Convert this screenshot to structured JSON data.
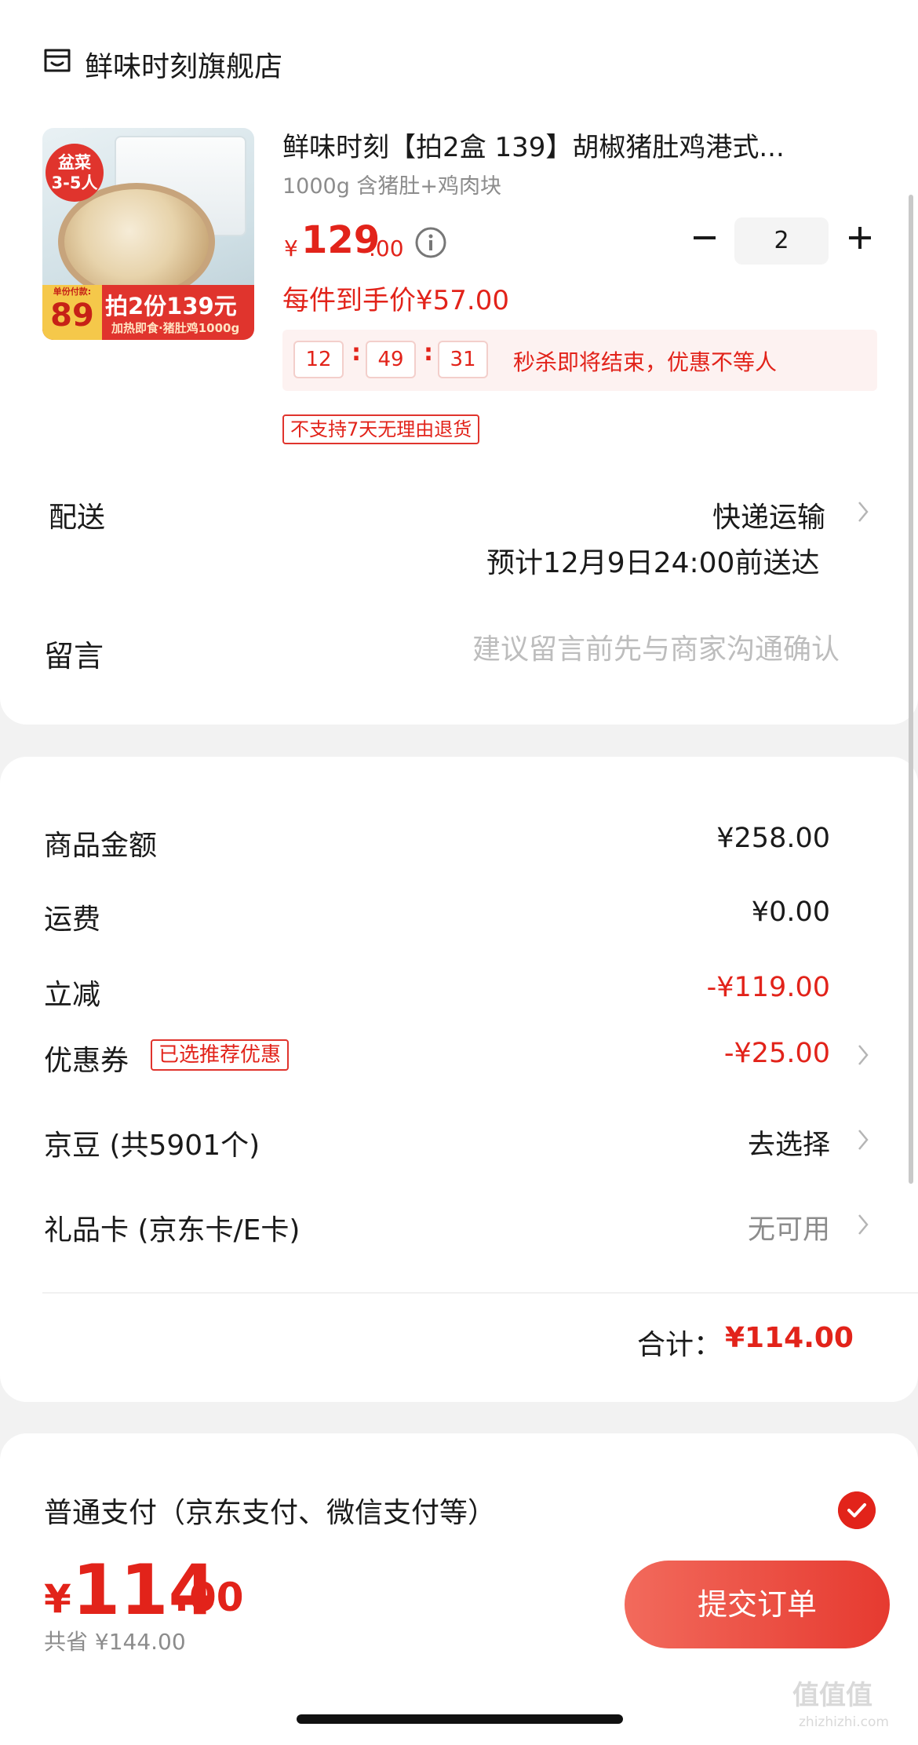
{
  "store": {
    "name": "鲜味时刻旗舰店",
    "icon": "store-icon"
  },
  "product": {
    "title": "鲜味时刻【拍2盒 139】胡椒猪肚鸡港式...",
    "spec": "1000g 含猪肚+鸡肉块",
    "price_symbol": "¥",
    "price_int": "129",
    "price_dec": ".00",
    "quantity": "2",
    "unit_price_text": "每件到手价¥57.00",
    "image": {
      "badge_top": "盆菜\n3-5人",
      "band_tag_small": "单份付款:",
      "band_tag_num": "89",
      "band_main": "拍2份139元",
      "band_sub": "加热即食·猪肚鸡1000g"
    },
    "flash_sale": {
      "hours": "12",
      "minutes": "49",
      "seconds": "31",
      "separator": ":",
      "text": "秒杀即将结束，优惠不等人"
    },
    "return_tag": "不支持7天无理由退货"
  },
  "shipping": {
    "label": "配送",
    "method": "快递运输",
    "eta": "预计12月9日24:00前送达"
  },
  "message": {
    "label": "留言",
    "placeholder": "建议留言前先与商家沟通确认"
  },
  "summary": {
    "rows": [
      {
        "label": "商品金额",
        "value": "¥258.00"
      },
      {
        "label": "运费",
        "value": "¥0.00"
      },
      {
        "label": "立减",
        "value": "-¥119.00"
      },
      {
        "label": "优惠券",
        "value": "-¥25.00",
        "tag": "已选推荐优惠"
      },
      {
        "label": "京豆 (共5901个)",
        "value": "去选择"
      },
      {
        "label": "礼品卡 (京东卡/E卡)",
        "value": "无可用"
      }
    ],
    "total_label": "合计：",
    "total_value": "¥114.00"
  },
  "payment": {
    "label": "普通支付（京东支付、微信支付等）",
    "selected": true
  },
  "bottom": {
    "yen": "¥",
    "total_int": "114",
    "total_dec": ".00",
    "saved": "共省 ¥144.00",
    "submit": "提交订单",
    "watermark": "值值值",
    "watermark_sub": "zhizhizhi.com"
  },
  "colors": {
    "accent": "#e2231a",
    "muted": "#8c8c8c",
    "background": "#f2f2f2"
  }
}
